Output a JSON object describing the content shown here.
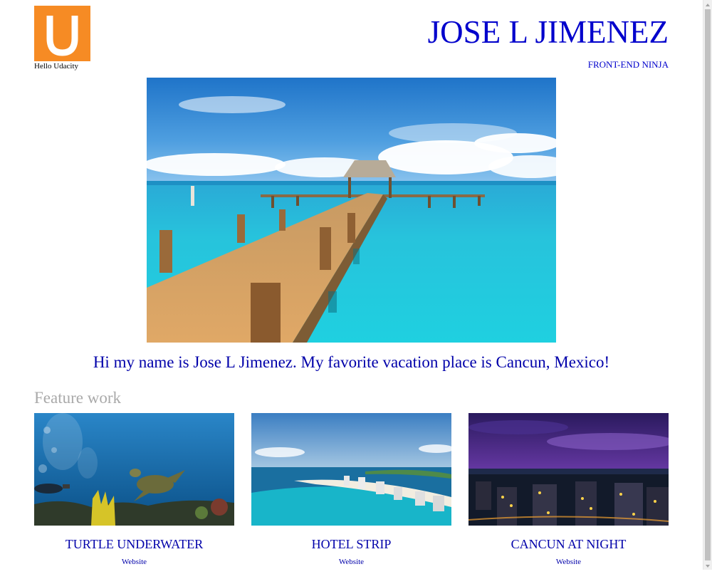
{
  "header": {
    "logo_letter": "U",
    "logo_caption": "Hello Udacity",
    "title": "JOSE L JIMENEZ",
    "subtitle": "FRONT-END NINJA"
  },
  "intro_text": "Hi my name is Jose L Jimenez. My favorite vacation place is Cancun, Mexico!",
  "featured": {
    "heading": "Feature work",
    "items": [
      {
        "title": "TURTLE UNDERWATER",
        "link": "Website"
      },
      {
        "title": "HOTEL STRIP",
        "link": "Website"
      },
      {
        "title": "CANCUN AT NIGHT",
        "link": "Website"
      }
    ]
  },
  "colors": {
    "logo_background": "#f68b24",
    "title": "#0000cc",
    "body_text": "#0000aa",
    "section_heading": "#a9a9a9"
  },
  "icons": {
    "logo": "udacity-u-logo",
    "scroll_up": "triangle-up",
    "scroll_down": "triangle-down"
  }
}
